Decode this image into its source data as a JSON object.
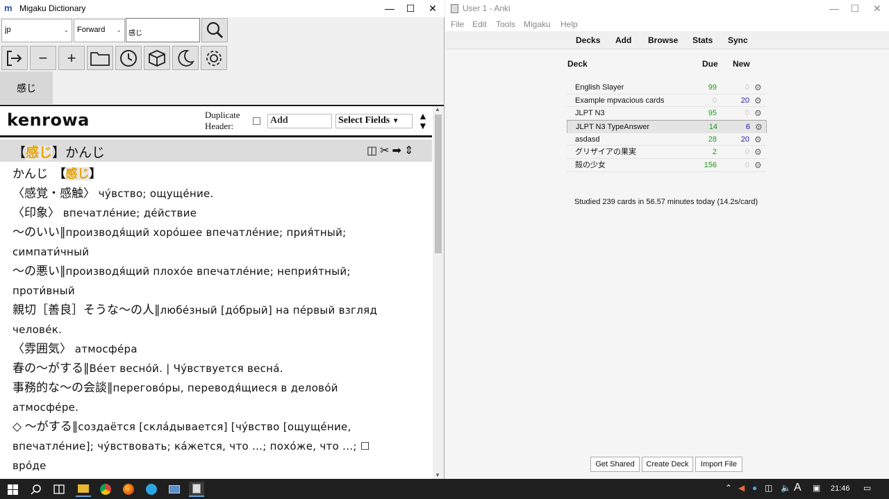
{
  "migaku": {
    "title": "Migaku Dictionary",
    "app_icon": "m",
    "language_select": "jp",
    "direction_select": "Forward",
    "search_value": "感じ",
    "history_tab": "感じ",
    "headword": "kenrowa",
    "duplicate_header_label_1": "Duplicate",
    "duplicate_header_label_2": "Header:",
    "add_label": "Add",
    "select_fields_label": "Select Fields",
    "entry_header": {
      "bracket_open": "【",
      "kanji": "感じ",
      "bracket_close": "】",
      "reading": "かんじ"
    },
    "entry_lines": [
      {
        "jp": "かんじ　",
        "kanji": "感じ",
        "jp2": "",
        "ru": ""
      },
      {
        "jp": "〈感覚・感触〉",
        "kanji": "",
        "jp2": "",
        "ru": "чу́вство; ощуще́ние."
      },
      {
        "jp": "〈印象〉",
        "kanji": "",
        "jp2": "",
        "ru": "впечатле́ние; де́йствие"
      },
      {
        "jp": "～のいい∥",
        "kanji": "",
        "jp2": "",
        "ru": "производя́щий хоро́шее впечатле́ние; прия́тный; симпати́чный"
      },
      {
        "jp": "～の悪い∥",
        "kanji": "",
        "jp2": "",
        "ru": "производя́щий плохо́е впечатле́ние; неприя́тный; проти́вный"
      },
      {
        "jp": "親切［善良］そうな～の人∥",
        "kanji": "",
        "jp2": "",
        "ru": "любе́зный [до́брый] на пе́рвый взгляд челове́к."
      },
      {
        "jp": "〈雰囲気〉",
        "kanji": "",
        "jp2": "",
        "ru": "атмосфе́ра"
      },
      {
        "jp": "春の～がする∥",
        "kanji": "",
        "jp2": "",
        "ru": "Ве́ет весно́й. | Чу́вствуется весна́."
      },
      {
        "jp": "事務的な～の会談∥",
        "kanji": "",
        "jp2": "",
        "ru": "перегово́ры, переводя́щиеся в делово́й атмосфе́ре."
      },
      {
        "jp": "◇ ～がする∥",
        "kanji": "",
        "jp2": "",
        "ru": "создаётся [скла́дывается] [чу́вство [ощуще́ние, впечатле́ние]; чу́вствовать; ка́жется, что ...; похо́же, что ...; ☐ вро́де"
      }
    ],
    "icons": [
      "exit-icon",
      "minus-icon",
      "plus-icon",
      "folder-icon",
      "history-icon",
      "cube-icon",
      "moon-icon",
      "gear-icon"
    ]
  },
  "anki": {
    "title": "User 1 - Anki",
    "menu": [
      "File",
      "Edit",
      "Tools",
      "Migaku",
      "Help"
    ],
    "toolbar": [
      "Decks",
      "Add",
      "Browse",
      "Stats",
      "Sync"
    ],
    "col_deck": "Deck",
    "col_due": "Due",
    "col_new": "New",
    "decks": [
      {
        "name": "English Slayer",
        "due": "99",
        "new": "0"
      },
      {
        "name": "Example mpvacious cards",
        "due": "0",
        "new": "20"
      },
      {
        "name": "JLPT N3",
        "due": "95",
        "new": "0"
      },
      {
        "name": "JLPT N3 TypeAnswer",
        "due": "14",
        "new": "6"
      },
      {
        "name": "asdasd",
        "due": "28",
        "new": "20"
      },
      {
        "name": "グリザイアの果実",
        "due": "2",
        "new": "0"
      },
      {
        "name": "殻の少女",
        "due": "156",
        "new": "0"
      }
    ],
    "stats_text": "Studied 239 cards in 56.57 minutes today (14.2s/card)",
    "buttons": [
      "Get Shared",
      "Create Deck",
      "Import File"
    ]
  },
  "taskbar": {
    "clock": "21:46",
    "language_indicator": "A",
    "colors": {
      "bg": "#1f1f1f"
    }
  }
}
